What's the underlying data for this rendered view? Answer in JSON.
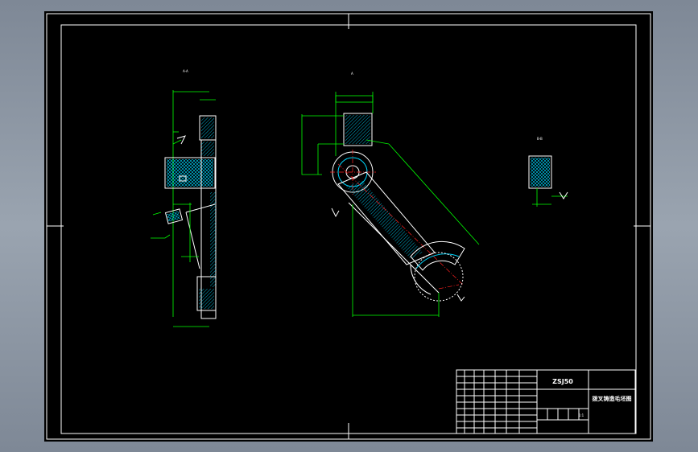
{
  "title_block": {
    "drawing_code": "ZSJ50",
    "drawing_name": "拨叉铸造毛坯图",
    "scale": "1:1"
  },
  "views": {
    "side_view_label": "A-A",
    "section_label": "B-B",
    "direction_label": "A"
  },
  "colors": {
    "background": "#000000",
    "outline": "#ffffff",
    "dimension": "#00ff00",
    "centerline": "#ff2020",
    "hatch": "#00d8ff"
  }
}
